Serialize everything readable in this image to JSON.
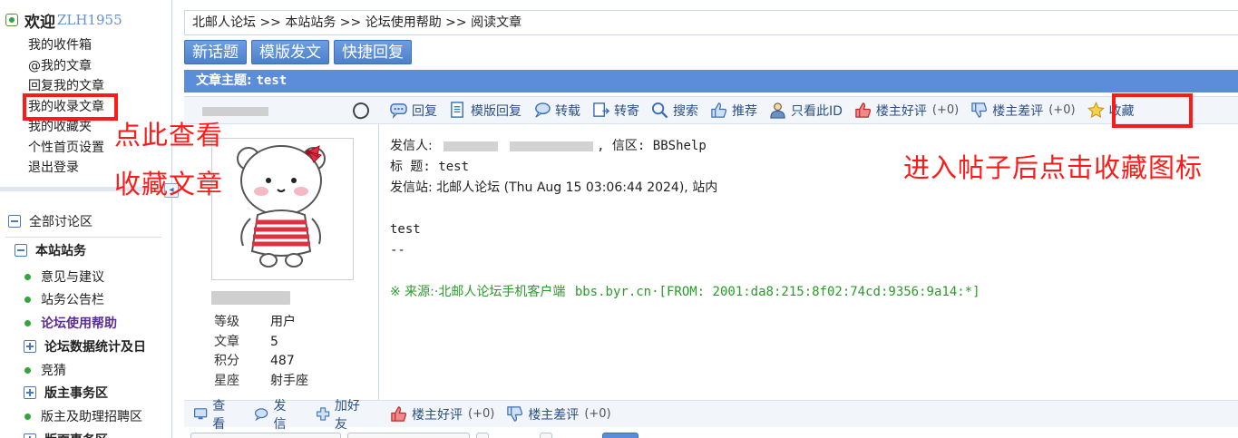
{
  "sidebar": {
    "welcome": "欢迎",
    "username": "ZLH1955",
    "menu": [
      "我的收件箱",
      "@我的文章",
      "回复我的文章",
      "我的收录文章",
      "我的收藏夹",
      "个性首页设置",
      "退出登录"
    ],
    "tree": {
      "root": "全部讨论区",
      "group": "本站站务",
      "items": [
        {
          "label": "意见与建议",
          "type": "dot"
        },
        {
          "label": "站务公告栏",
          "type": "dot"
        },
        {
          "label": "论坛使用帮助",
          "type": "dot-active"
        },
        {
          "label": "论坛数据统计及日",
          "type": "plus"
        },
        {
          "label": "竞猜",
          "type": "dot"
        },
        {
          "label": "版主事务区",
          "type": "plus"
        },
        {
          "label": "版主及助理招聘区",
          "type": "dot"
        },
        {
          "label": "版面事务区",
          "type": "plus"
        }
      ]
    }
  },
  "breadcrumb": "北邮人论坛 >> 本站站务 >> 论坛使用帮助 >> 阅读文章",
  "toolbar": {
    "new_topic": "新话题",
    "template_post": "模版发文",
    "quick_reply": "快捷回复"
  },
  "subject": {
    "label": "文章主题:",
    "value": "test"
  },
  "author": {
    "stats": [
      {
        "key": "等级",
        "value": "用户"
      },
      {
        "key": "文章",
        "value": "5"
      },
      {
        "key": "积分",
        "value": "487"
      },
      {
        "key": "星座",
        "value": "射手座"
      }
    ],
    "footer": {
      "view": "查看",
      "message": "发信",
      "add_friend": "加好友"
    }
  },
  "actions": {
    "reply": "回复",
    "template_reply": "模版回复",
    "forward": "转载",
    "mail": "转寄",
    "search": "搜索",
    "recommend": "推荐",
    "only_this_id": "只看此ID",
    "good": "楼主好评",
    "good_count": "(+0)",
    "bad": "楼主差评",
    "bad_count": "(+0)",
    "favorite": "收藏"
  },
  "post": {
    "from_label": "发信人:",
    "board_suffix": ", 信区: BBShelp",
    "title_line": "标    题: test",
    "site_line": "发信站: 北邮人论坛 (Thu Aug 15 03:06:44 2024), 站内",
    "body": "test",
    "sig": "--",
    "source_prefix": "※ 来源:·北邮人论坛手机客户端",
    "source_suffix": "bbs.byr.cn·[FROM: 2001:da8:215:8f02:74cd:9356:9a14:*]"
  },
  "footer_actions": {
    "good": "楼主好评",
    "good_count": "(+0)",
    "bad": "楼主差评",
    "bad_count": "(+0)"
  },
  "annotations": {
    "left_line1": "点此查看",
    "left_line2": "收藏文章",
    "right": "进入帖子后点击收藏图标"
  },
  "colors": {
    "accent_blue": "#5b8ddb",
    "annotation_red": "#ff1a1a",
    "source_green": "#2a9a2a",
    "active_purple": "#5c2d91"
  },
  "icons": [
    "reply-icon",
    "template-reply-icon",
    "forward-icon",
    "mail-icon",
    "search-icon",
    "thumbs-up-icon",
    "person-icon",
    "good-icon",
    "bad-icon",
    "star-icon",
    "pin-icon",
    "monitor-icon",
    "chat-icon",
    "plus-icon"
  ]
}
